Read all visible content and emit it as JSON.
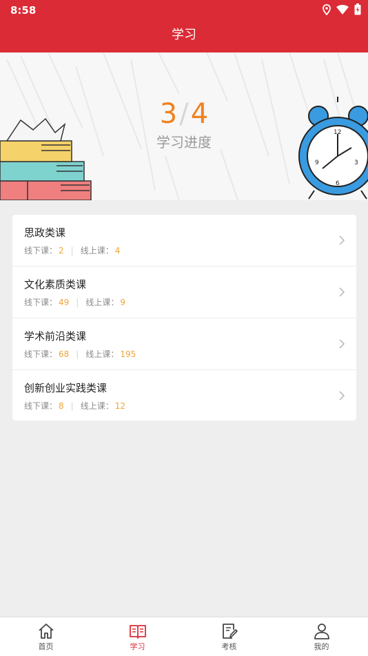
{
  "status_bar": {
    "time": "8:58"
  },
  "header": {
    "title": "学习"
  },
  "progress": {
    "done": "3",
    "separator": "/",
    "total": "4",
    "label": "学习进度"
  },
  "courses": [
    {
      "name": "思政类课",
      "offline_label": "线下课：",
      "offline": "2",
      "online_label": "线上课：",
      "online": "4"
    },
    {
      "name": "文化素质类课",
      "offline_label": "线下课：",
      "offline": "49",
      "online_label": "线上课：",
      "online": "9"
    },
    {
      "name": "学术前沿类课",
      "offline_label": "线下课：",
      "offline": "68",
      "online_label": "线上课：",
      "online": "195"
    },
    {
      "name": "创新创业实践类课",
      "offline_label": "线下课：",
      "offline": "8",
      "online_label": "线上课：",
      "online": "12"
    }
  ],
  "tabs": [
    {
      "label": "首页",
      "icon": "home-icon"
    },
    {
      "label": "学习",
      "icon": "book-icon"
    },
    {
      "label": "考核",
      "icon": "edit-document-icon"
    },
    {
      "label": "我的",
      "icon": "user-icon"
    }
  ],
  "colors": {
    "primary": "#db2b36",
    "accent": "#f0821e",
    "count": "#f0a436"
  }
}
